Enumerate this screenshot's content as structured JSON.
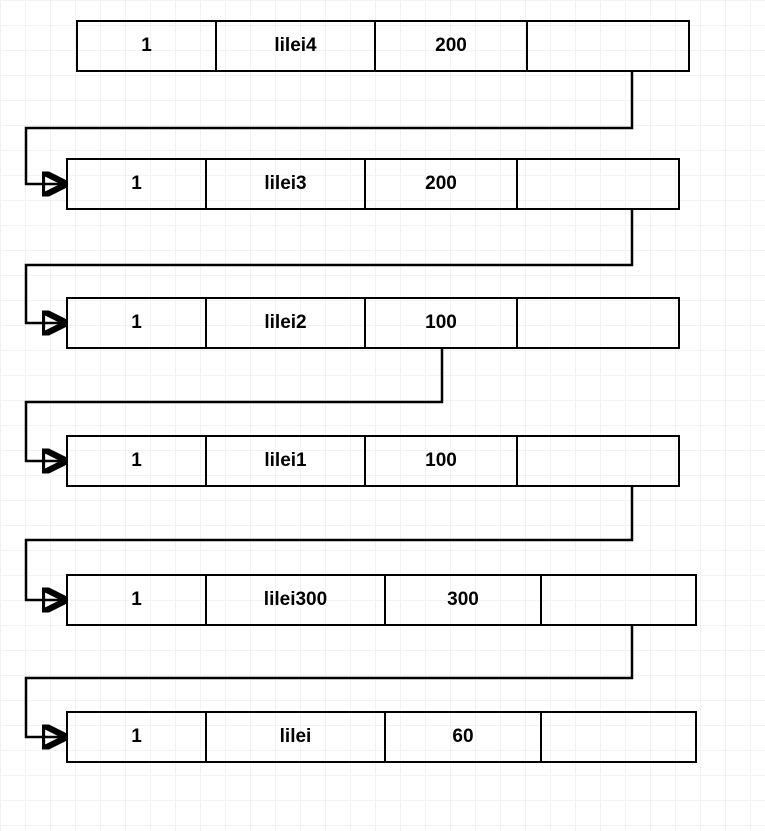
{
  "diagram_type": "linked-list",
  "nodes": [
    {
      "id": "1",
      "name": "lilei4",
      "value": "200",
      "extra": ""
    },
    {
      "id": "1",
      "name": "lilei3",
      "value": "200",
      "extra": ""
    },
    {
      "id": "1",
      "name": "lilei2",
      "value": "100",
      "extra": ""
    },
    {
      "id": "1",
      "name": "lilei1",
      "value": "100",
      "extra": ""
    },
    {
      "id": "1",
      "name": "lilei300",
      "value": "300",
      "extra": ""
    },
    {
      "id": "1",
      "name": "lilei",
      "value": "60",
      "extra": ""
    }
  ]
}
